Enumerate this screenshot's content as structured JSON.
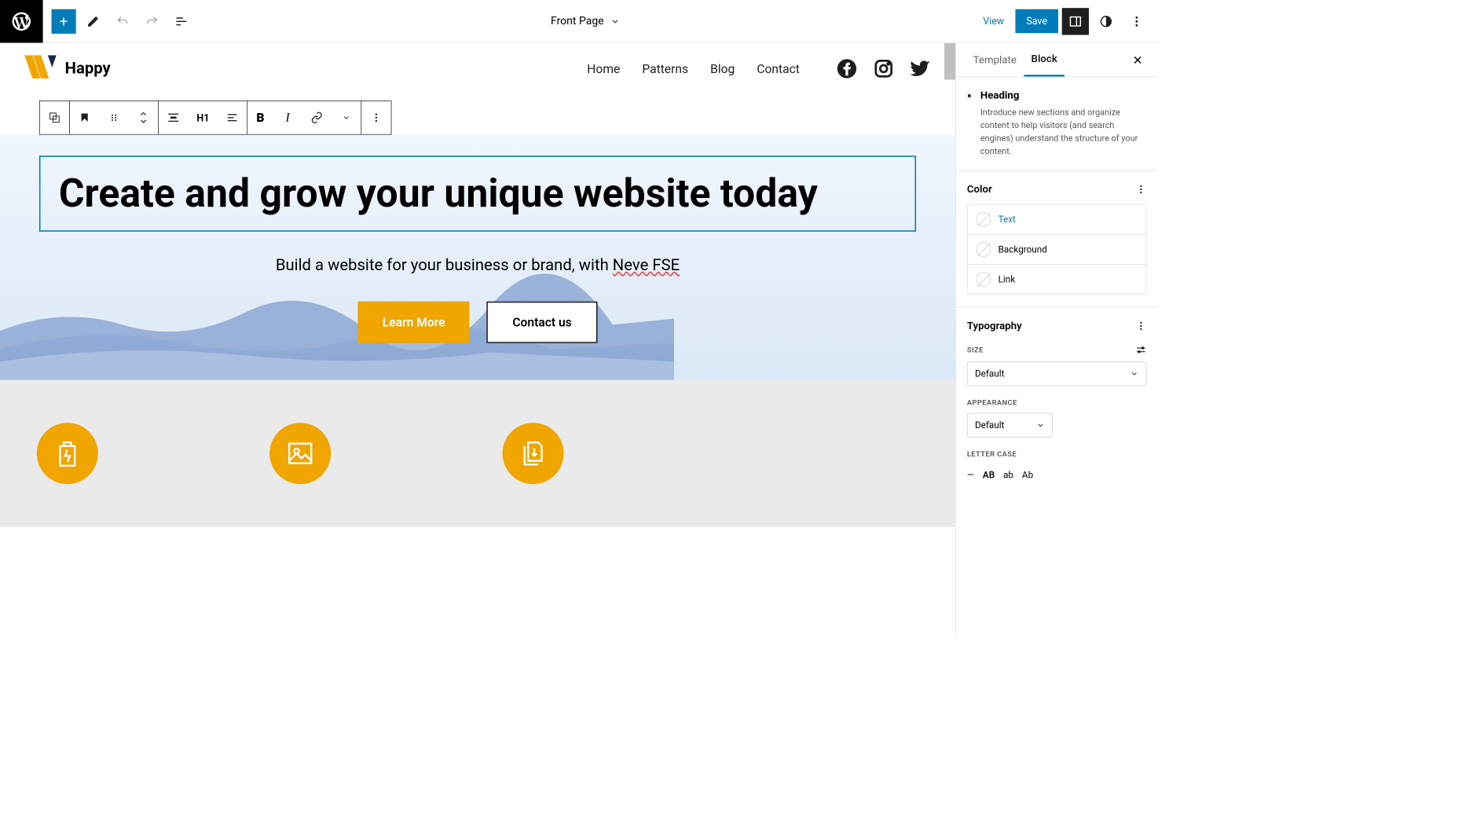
{
  "topbar": {
    "page_title": "Front Page",
    "view": "View",
    "save": "Save"
  },
  "site": {
    "name": "Happy",
    "nav": [
      "Home",
      "Patterns",
      "Blog",
      "Contact"
    ]
  },
  "block_toolbar": {
    "heading_level": "H1"
  },
  "hero": {
    "heading": "Create and grow your unique website today",
    "sub_prefix": "Build a website for your business or brand, with ",
    "sub_underlined": "Neve FSE",
    "btn_primary": "Learn More",
    "btn_outline": "Contact us"
  },
  "sidebar": {
    "tabs": {
      "template": "Template",
      "block": "Block"
    },
    "block_info": {
      "title": "Heading",
      "desc": "Introduce new sections and organize content to help visitors (and search engines) understand the structure of your content."
    },
    "color": {
      "title": "Color",
      "items": {
        "text": "Text",
        "background": "Background",
        "link": "Link"
      }
    },
    "typography": {
      "title": "Typography",
      "size_label": "SIZE",
      "size_value": "Default",
      "appearance_label": "APPEARANCE",
      "appearance_value": "Default",
      "lettercase_label": "LETTER CASE",
      "lettercase_opts": [
        "—",
        "AB",
        "ab",
        "Ab"
      ]
    }
  }
}
